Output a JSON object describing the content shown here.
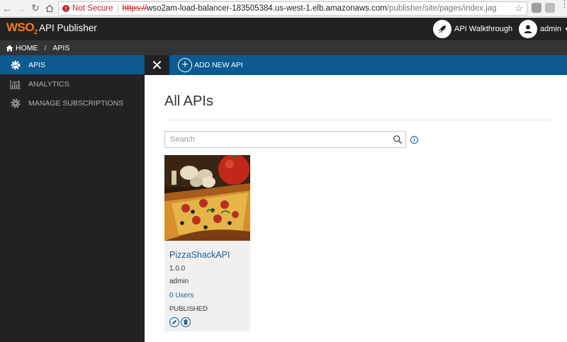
{
  "browser": {
    "security_label": "Not Secure",
    "url_scheme": "https://",
    "url_host": "wso2am-load-balancer-183505384.us-west-1.elb.amazonaws.com",
    "url_path": "/publisher/site/pages/index.jag"
  },
  "header": {
    "logo_text": "WSO",
    "logo_sub": "2",
    "app_title": "API Publisher",
    "walkthrough_label": "API Walkthrough",
    "user_label": "admin"
  },
  "breadcrumb": {
    "home": "HOME",
    "separator": "/",
    "current": "APIS"
  },
  "sidebar": {
    "items": [
      {
        "label": "APIS",
        "icon": "apis-gear-icon",
        "active": true
      },
      {
        "label": "ANALYTICS",
        "icon": "chart-icon",
        "active": false
      },
      {
        "label": "MANAGE SUBSCRIPTIONS",
        "icon": "gear-icon",
        "active": false
      }
    ]
  },
  "toolbar": {
    "add_label": "ADD NEW API"
  },
  "main": {
    "title": "All APIs",
    "search_placeholder": "Search"
  },
  "apis": [
    {
      "name": "PizzaShackAPI",
      "version": "1.0.0",
      "owner": "admin",
      "users": "0 Users",
      "status": "PUBLISHED"
    }
  ],
  "colors": {
    "accent": "#0c5a8f",
    "brand": "#f47b20",
    "header_bg": "#222222",
    "link": "#1a5e8f"
  }
}
